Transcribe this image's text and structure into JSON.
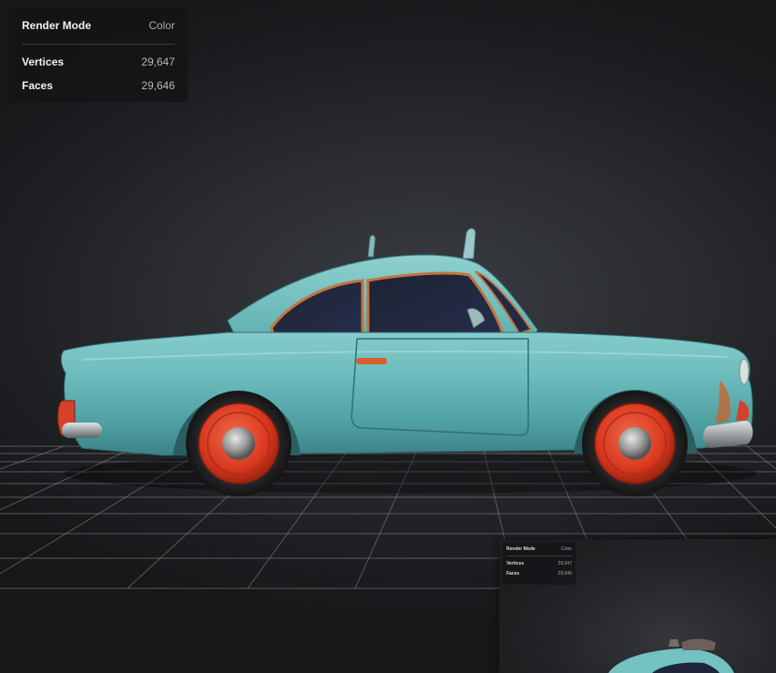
{
  "stats_panel": {
    "render_mode_label": "Render Mode",
    "render_mode_value": "Color",
    "vertices_label": "Vertices",
    "vertices_value": "29,647",
    "faces_label": "Faces",
    "faces_value": "29,646"
  },
  "preview_thumbnail": {
    "render_mode_label": "Render Mode",
    "render_mode_value": "Color",
    "vertices_label": "Vertices",
    "vertices_value": "29,647",
    "faces_label": "Faces",
    "faces_value": "29,646"
  },
  "colors": {
    "background": "#1a1b1d",
    "car_body": "#63b3b5",
    "wheel_rim": "#e2402a",
    "grid_lines": "#8a8c90"
  },
  "model": {
    "description_icon": "car-model"
  }
}
